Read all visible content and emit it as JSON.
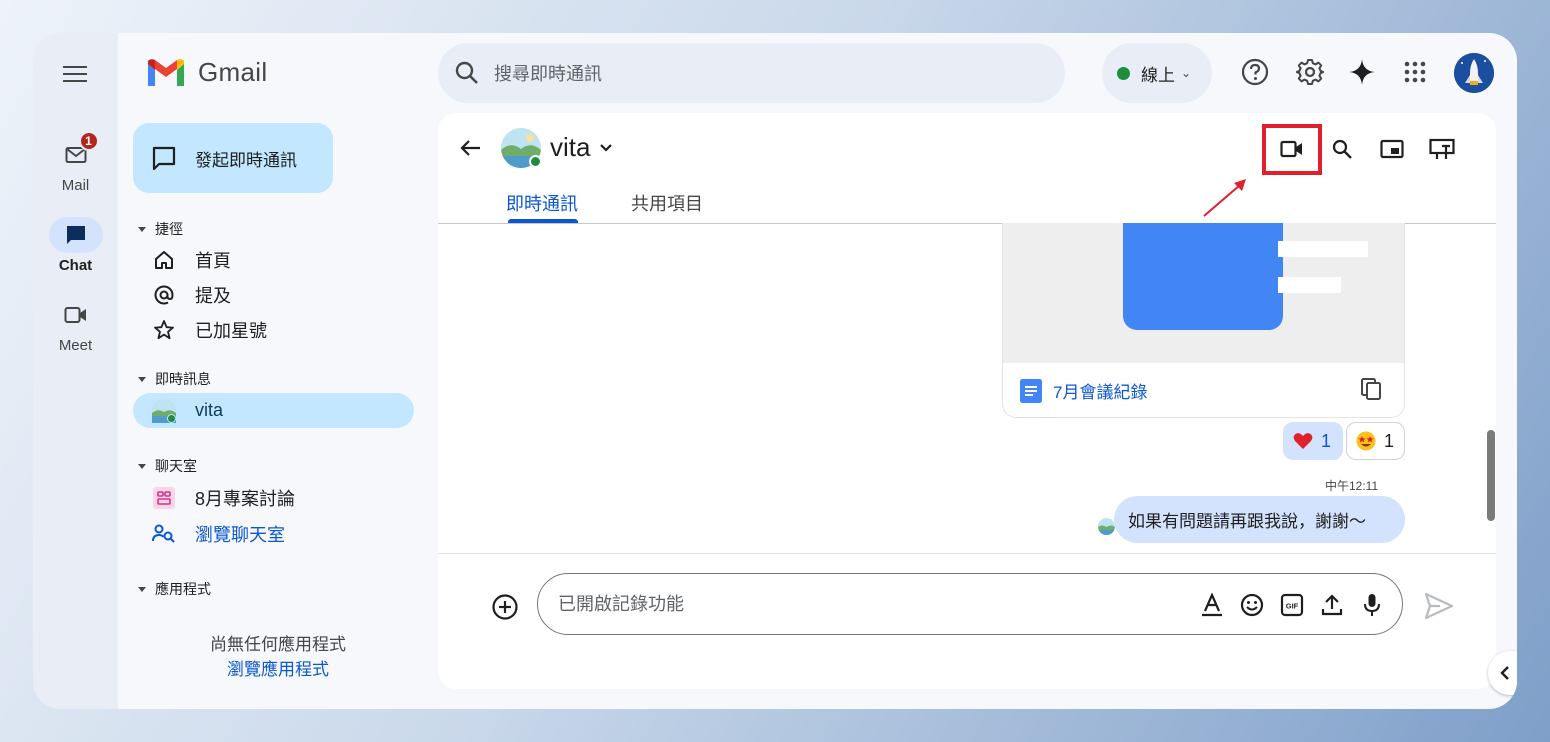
{
  "rail": {
    "items": [
      {
        "label": "Mail",
        "badge": "1"
      },
      {
        "label": "Chat"
      },
      {
        "label": "Meet"
      }
    ]
  },
  "brand": {
    "name": "Gmail"
  },
  "nav": {
    "compose_label": "發起即時通訊",
    "shortcuts": {
      "title": "捷徑",
      "items": [
        "首頁",
        "提及",
        "已加星號"
      ]
    },
    "dms": {
      "title": "即時訊息",
      "items": [
        "vita"
      ]
    },
    "spaces": {
      "title": "聊天室",
      "items": [
        "8月專案討論",
        "瀏覽聊天室"
      ]
    },
    "apps": {
      "title": "應用程式",
      "empty": "尚無任何應用程式",
      "browse": "瀏覽應用程式"
    }
  },
  "search": {
    "placeholder": "搜尋即時通訊"
  },
  "status": {
    "label": "線上",
    "color": "#1e8e3e"
  },
  "conversation": {
    "name": "vita",
    "tabs": [
      "即時通訊",
      "共用項目"
    ],
    "attachment": {
      "file_name": "7月會議紀錄"
    },
    "reactions": [
      {
        "emoji": "heart",
        "count": "1"
      },
      {
        "emoji": "star-struck",
        "count": "1"
      }
    ],
    "time": "中午12:11",
    "message": "如果有問題請再跟我說，謝謝～"
  },
  "composer": {
    "placeholder": "已開啟記錄功能"
  },
  "colors": {
    "accent": "#0b57d0",
    "highlight": "#e0202a"
  }
}
